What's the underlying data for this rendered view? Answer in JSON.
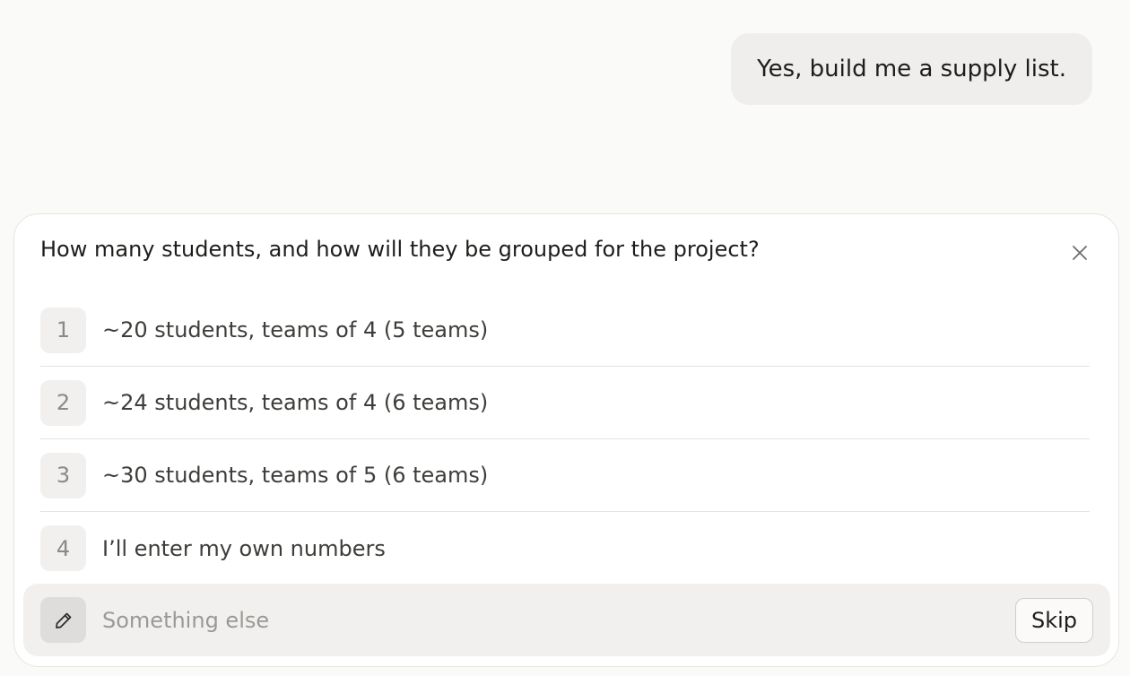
{
  "chat": {
    "user_message": "Yes, build me a supply list."
  },
  "prompt": {
    "question": "How many students, and how will they be grouped for the project?",
    "options": [
      {
        "number": "1",
        "label": "~20 students, teams of 4 (5 teams)"
      },
      {
        "number": "2",
        "label": "~24 students, teams of 4 (6 teams)"
      },
      {
        "number": "3",
        "label": "~30 students, teams of 5 (6 teams)"
      },
      {
        "number": "4",
        "label": "I’ll enter my own numbers"
      }
    ],
    "custom": {
      "placeholder": "Something else",
      "value": "",
      "icon": "pencil-icon"
    },
    "skip_label": "Skip",
    "close_icon": "close-icon"
  }
}
